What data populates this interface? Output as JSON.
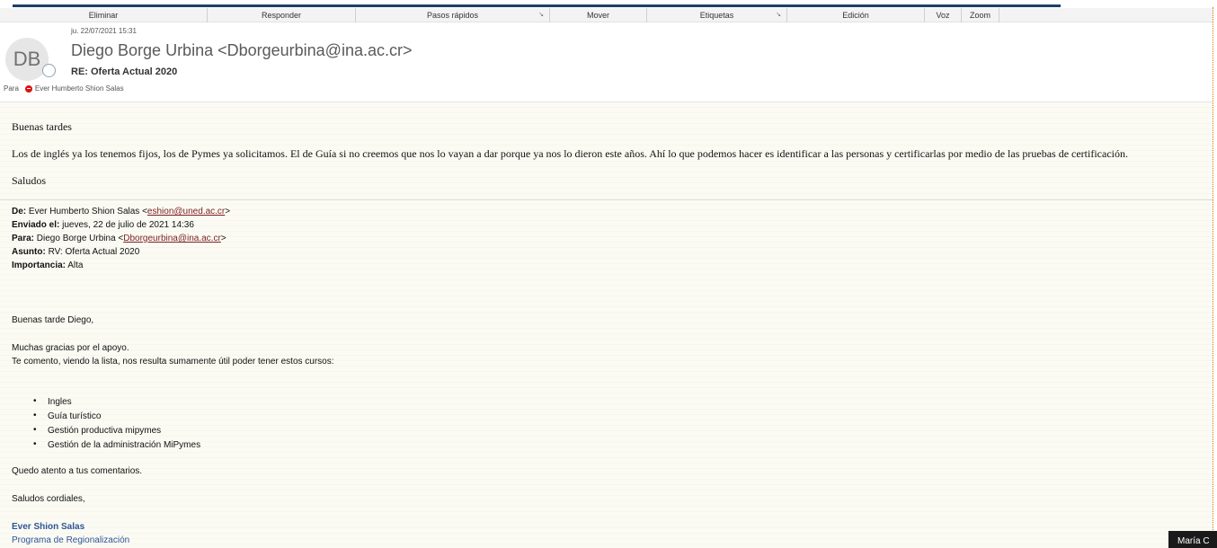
{
  "ribbon": {
    "groups": [
      {
        "label": "Eliminar",
        "launcher": false
      },
      {
        "label": "Responder",
        "launcher": false
      },
      {
        "label": "Pasos rápidos",
        "launcher": true
      },
      {
        "label": "Mover",
        "launcher": false
      },
      {
        "label": "Etiquetas",
        "launcher": true
      },
      {
        "label": "Edición",
        "launcher": false
      },
      {
        "label": "Voz",
        "launcher": false
      },
      {
        "label": "Zoom",
        "launcher": false
      }
    ],
    "launcher_glyph": "↘"
  },
  "message": {
    "date": "ju. 22/07/2021 15:31",
    "avatar_initials": "DB",
    "sender": "Diego Borge Urbina <Dborgeurbina@ina.ac.cr>",
    "subject": "RE: Oferta Actual 2020",
    "to_label": "Para",
    "recipient": "Ever Humberto Shion Salas"
  },
  "reply": {
    "greeting": "Buenas tardes",
    "paragraph": "Los de inglés ya los tenemos fijos, los de Pymes ya solicitamos. El de Guía si no creemos que nos lo vayan a dar porque ya nos lo dieron este años. Ahí lo que podemos hacer es identificar a las personas y certificarlas por medio de las pruebas de certificación.",
    "closing": "Saludos"
  },
  "quoted": {
    "from_label": "De:",
    "from_name": "Ever Humberto Shion Salas <",
    "from_email": "eshion@uned.ac.cr",
    "from_end": ">",
    "sent_label": "Enviado el:",
    "sent_value": "jueves, 22 de julio de 2021 14:36",
    "to_label": "Para:",
    "to_name": "Diego Borge Urbina <",
    "to_email": "Dborgeurbina@ina.ac.cr",
    "to_end": ">",
    "subject_label": "Asunto:",
    "subject_value": "RV: Oferta Actual 2020",
    "importance_label": "Importancia:",
    "importance_value": "Alta",
    "greeting": "Buenas tarde Diego,",
    "thanks": "Muchas gracias por el apoyo.",
    "intro": "Te comento, viendo la lista, nos resulta sumamente útil poder tener estos cursos:",
    "courses": [
      "Ingles",
      "Guía turístico",
      "Gestión productiva mipymes",
      "Gestión de la administración MiPymes"
    ],
    "waiting": "Quedo atento a tus comentarios.",
    "regards": "Saludos cordiales,",
    "sig_name": "Ever Shion Salas",
    "sig_dept": "Programa de Regionalización"
  },
  "tooltip": "María C"
}
